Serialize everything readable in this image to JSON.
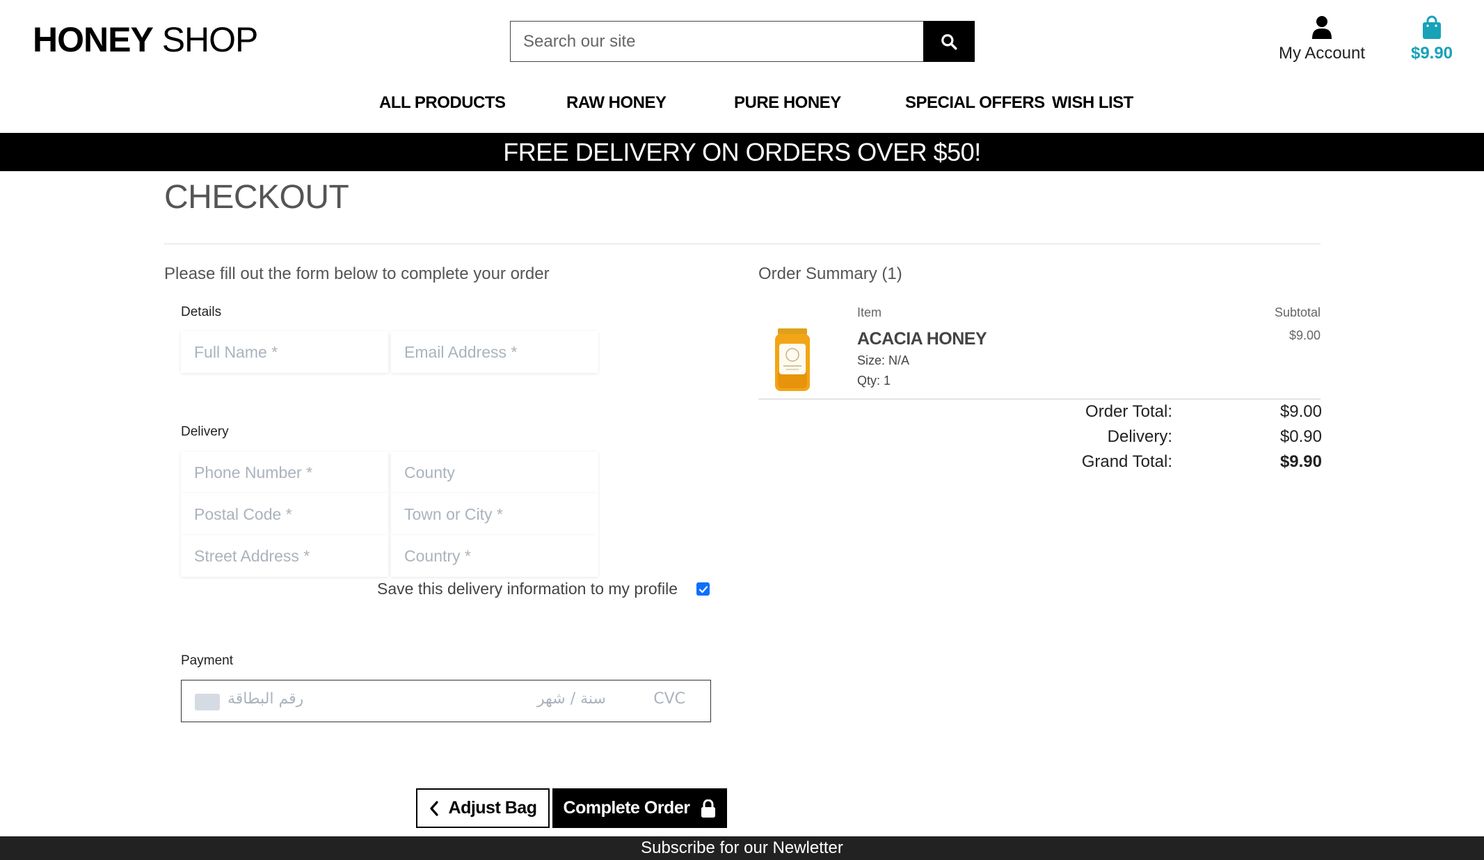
{
  "header": {
    "logo_bold": "HONEY",
    "logo_light": " SHOP",
    "search_placeholder": "Search our site",
    "account_label": "My Account",
    "bag_total": "$9.90"
  },
  "nav": {
    "items": [
      "ALL PRODUCTS",
      "RAW HONEY",
      "PURE HONEY",
      "SPECIAL OFFERS",
      "WISH LIST"
    ]
  },
  "banner": {
    "text": "FREE DELIVERY ON ORDERS OVER $50!"
  },
  "page": {
    "title": "CHECKOUT"
  },
  "form": {
    "intro": "Please fill out the form below to complete your order",
    "details_legend": "Details",
    "full_name_placeholder": "Full Name *",
    "email_placeholder": "Email Address *",
    "delivery_legend": "Delivery",
    "phone_placeholder": "Phone Number *",
    "county_placeholder": "County",
    "postal_placeholder": "Postal Code *",
    "town_placeholder": "Town or City *",
    "street_placeholder": "Street Address *",
    "country_placeholder": "Country *",
    "save_info_label": "Save this delivery information to my profile",
    "save_info_checked": true,
    "payment_legend": "Payment",
    "card_number_placeholder": "رقم البطاقة",
    "card_expiry_placeholder": "سنة / شهر",
    "card_cvc_placeholder": "CVC"
  },
  "buttons": {
    "adjust_bag": "Adjust Bag",
    "complete_order": "Complete Order"
  },
  "summary": {
    "title": "Order Summary (1)",
    "col_item": "Item",
    "col_subtotal": "Subtotal",
    "product_name": "ACACIA HONEY",
    "product_size": "Size: N/A",
    "product_qty": "Qty: 1",
    "product_subtotal": "$9.00",
    "order_total_label": "Order Total:",
    "order_total_value": "$9.00",
    "delivery_label": "Delivery:",
    "delivery_value": "$0.90",
    "grand_total_label": "Grand Total:",
    "grand_total_value": "$9.90"
  },
  "footer": {
    "text": "Subscribe for our Newletter"
  },
  "colors": {
    "accent": "#17a2b8",
    "checkbox": "#0d6efd",
    "honey": "#f2a516"
  }
}
